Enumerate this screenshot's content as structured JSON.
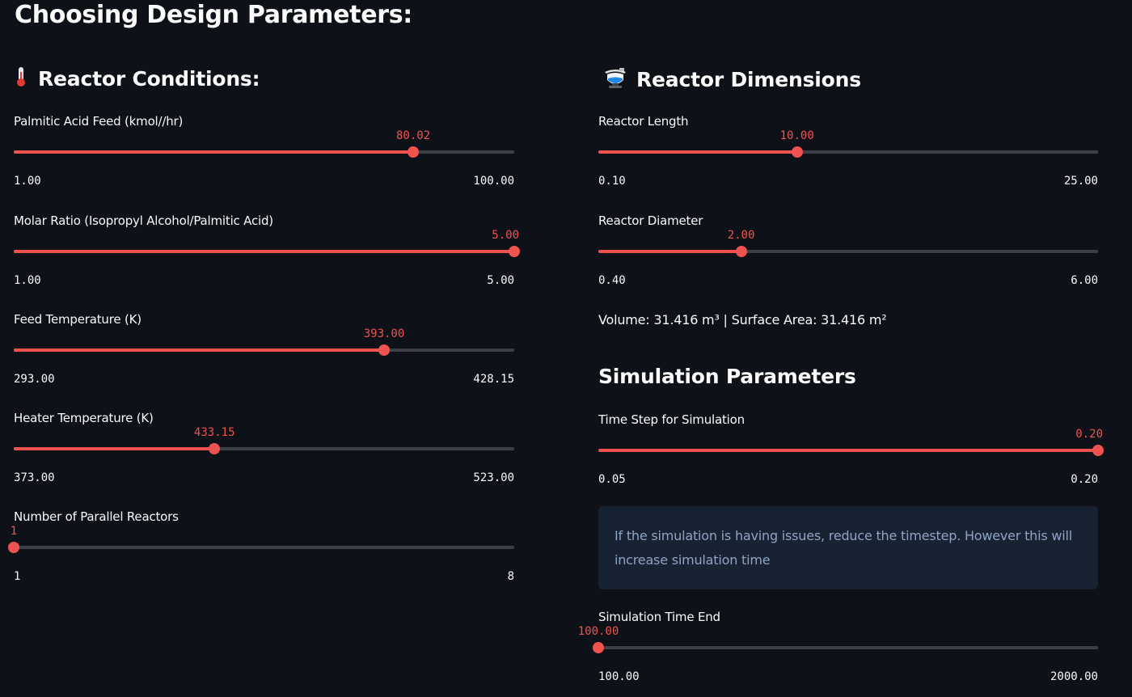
{
  "page_title": "Choosing Design Parameters:",
  "colors": {
    "accent": "#ef5350",
    "background": "#0e1117",
    "info_bg": "#172233",
    "info_text": "#8fa4c4"
  },
  "reactor_conditions": {
    "icon": "thermometer-icon",
    "title": "Reactor Conditions:",
    "sliders": [
      {
        "label": "Palmitic Acid Feed (kmol//hr)",
        "value": "80.02",
        "min": "1.00",
        "max": "100.00"
      },
      {
        "label": "Molar Ratio (Isopropyl Alcohol/Palmitic Acid)",
        "value": "5.00",
        "min": "1.00",
        "max": "5.00"
      },
      {
        "label": "Feed Temperature (K)",
        "value": "393.00",
        "min": "293.00",
        "max": "428.15"
      },
      {
        "label": "Heater Temperature (K)",
        "value": "433.15",
        "min": "373.00",
        "max": "523.00"
      },
      {
        "label": "Number of Parallel Reactors",
        "value": "1",
        "min": "1",
        "max": "8"
      }
    ]
  },
  "reactor_dimensions": {
    "icon": "reactor-vessel-icon",
    "title": "Reactor Dimensions",
    "sliders": [
      {
        "label": "Reactor Length",
        "value": "10.00",
        "min": "0.10",
        "max": "25.00"
      },
      {
        "label": "Reactor Diameter",
        "value": "2.00",
        "min": "0.40",
        "max": "6.00"
      }
    ],
    "summary": "Volume: 31.416 m³ | Surface Area: 31.416 m²"
  },
  "simulation_parameters": {
    "title": "Simulation Parameters",
    "sliders": [
      {
        "label": "Time Step for Simulation",
        "value": "0.20",
        "min": "0.05",
        "max": "0.20"
      },
      {
        "label": "Simulation Time End",
        "value": "100.00",
        "min": "100.00",
        "max": "2000.00"
      }
    ],
    "info": "If the simulation is having issues, reduce the timestep. However this will increase simulation time"
  }
}
